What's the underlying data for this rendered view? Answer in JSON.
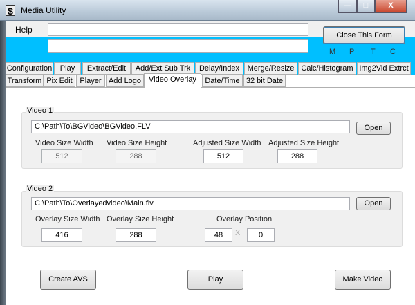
{
  "window": {
    "title": "Media Utility",
    "app_icon": "dollar-logo-icon",
    "controls": {
      "minimize": "—",
      "maximize": "□",
      "close": "X"
    }
  },
  "menu": {
    "help": "Help",
    "textbox1": "",
    "textbox2": "",
    "close_button": "Close This Form",
    "indicators": [
      "M",
      "P",
      "T",
      "C"
    ]
  },
  "colors": {
    "accent": "#00bfff"
  },
  "tabs": {
    "row1": [
      "Configuration",
      "Play",
      "Extract/Edit",
      "Add/Ext Sub Trk",
      "Delay/Index",
      "Merge/Resize",
      "Calc/Histogram",
      "Img2Vid Extrct"
    ],
    "row2": [
      "Transform",
      "Pix Edit",
      "Player",
      "Add Logo",
      "Video Overlay",
      "Date/Time",
      "32 bit Date"
    ],
    "selected": "Video Overlay"
  },
  "video1": {
    "label": "Video 1",
    "path": "C:\\Path\\To\\BGVideo\\BGVideo.FLV",
    "open": "Open",
    "fields": [
      {
        "label": "Video Size Width",
        "value": "512",
        "disabled": true
      },
      {
        "label": "Video Size Height",
        "value": "288",
        "disabled": true
      },
      {
        "label": "Adjusted Size Width",
        "value": "512"
      },
      {
        "label": "Adjusted Size Height",
        "value": "288"
      }
    ]
  },
  "video2": {
    "label": "Video 2",
    "path": "C:\\Path\\To\\Overlayedvideo\\Main.flv",
    "open": "Open",
    "fields": [
      {
        "label": "Overlay Size Width",
        "value": "416"
      },
      {
        "label": "Overlay Size Height",
        "value": "288"
      }
    ],
    "position": {
      "label": "Overlay Position",
      "x": "48",
      "separator": "X",
      "y": "0"
    }
  },
  "actions": {
    "create_avs": "Create AVS",
    "play": "Play",
    "make_video": "Make Video"
  }
}
